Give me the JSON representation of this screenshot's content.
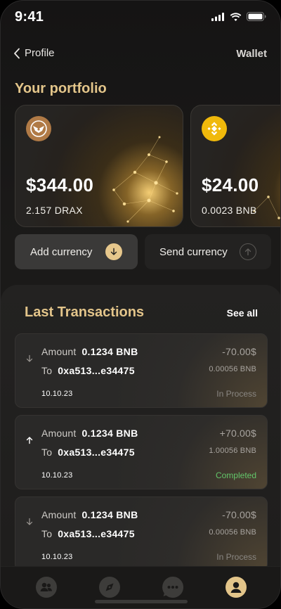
{
  "status_bar": {
    "time": "9:41"
  },
  "nav": {
    "back_label": "Profile",
    "title": "Wallet"
  },
  "portfolio": {
    "title": "Your portfolio",
    "cards": [
      {
        "amount": "$344.00",
        "holding": "2.157 DRAX",
        "coin_icon": "drax-coin-icon",
        "coin_color": "#b07a46"
      },
      {
        "amount": "$24.00",
        "holding": "0.0023 BNB",
        "coin_icon": "bnb-coin-icon",
        "coin_color": "#f0b90b"
      }
    ]
  },
  "actions": {
    "add_label": "Add currency",
    "send_label": "Send currency"
  },
  "transactions": {
    "title": "Last Transactions",
    "see_all": "See all",
    "amount_label": "Amount",
    "to_label": "To",
    "items": [
      {
        "direction": "down",
        "amount": "0.1234 BNB",
        "to": "0xa513...e34475",
        "value": "-70.00$",
        "token_value": "0.00056 BNB",
        "date": "10.10.23",
        "status": "In Process"
      },
      {
        "direction": "up",
        "amount": "0.1234 BNB",
        "to": "0xa513...e34475",
        "value": "+70.00$",
        "token_value": "1.00056 BNB",
        "date": "10.10.23",
        "status": "Completed"
      },
      {
        "direction": "down",
        "amount": "0.1234 BNB",
        "to": "0xa513...e34475",
        "value": "-70.00$",
        "token_value": "0.00056 BNB",
        "date": "10.10.23",
        "status": "In Process"
      }
    ]
  },
  "tabbar": {
    "items": [
      "users-icon",
      "compass-icon",
      "chat-icon",
      "profile-icon"
    ],
    "active_color": "#e3c58a"
  },
  "colors": {
    "accent": "#e3c58a",
    "success": "#63c56a"
  }
}
